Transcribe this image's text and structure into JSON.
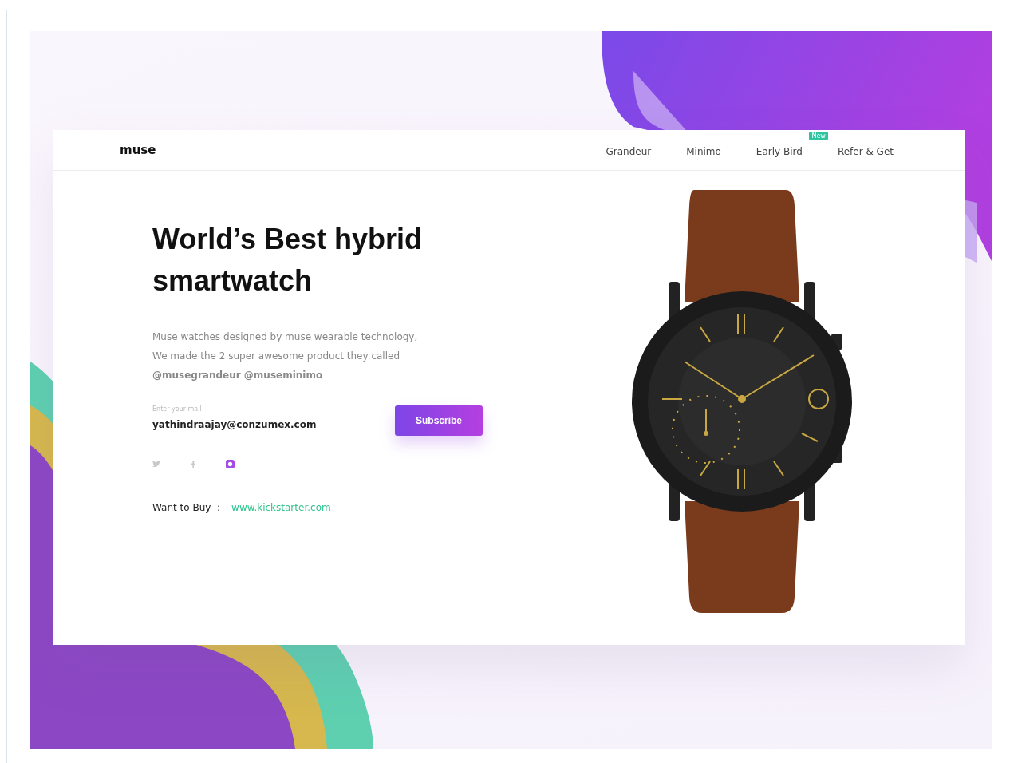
{
  "brand": "muse",
  "nav": [
    {
      "label": "Grandeur"
    },
    {
      "label": "Minimo"
    },
    {
      "label": "Early Bird",
      "badge": "New"
    },
    {
      "label": "Refer & Get"
    }
  ],
  "heading": "World’s Best hybrid smartwatch",
  "description": [
    "Muse watches designed by muse wearable technology,",
    "We made the 2 super awesome product  they called",
    "**@musegrandeur @museminimo**"
  ],
  "email": {
    "label": "Enter your mail",
    "value": "yathindraajay@conzumex.com"
  },
  "subscribe_button": "Subscribe",
  "social": [
    {
      "kind": "twitter",
      "selected": false
    },
    {
      "kind": "facebook",
      "selected": false
    },
    {
      "kind": "instagram",
      "selected": true
    }
  ],
  "buy": {
    "label": "Want to Buy  :",
    "link": "www.kickstarter.com"
  }
}
